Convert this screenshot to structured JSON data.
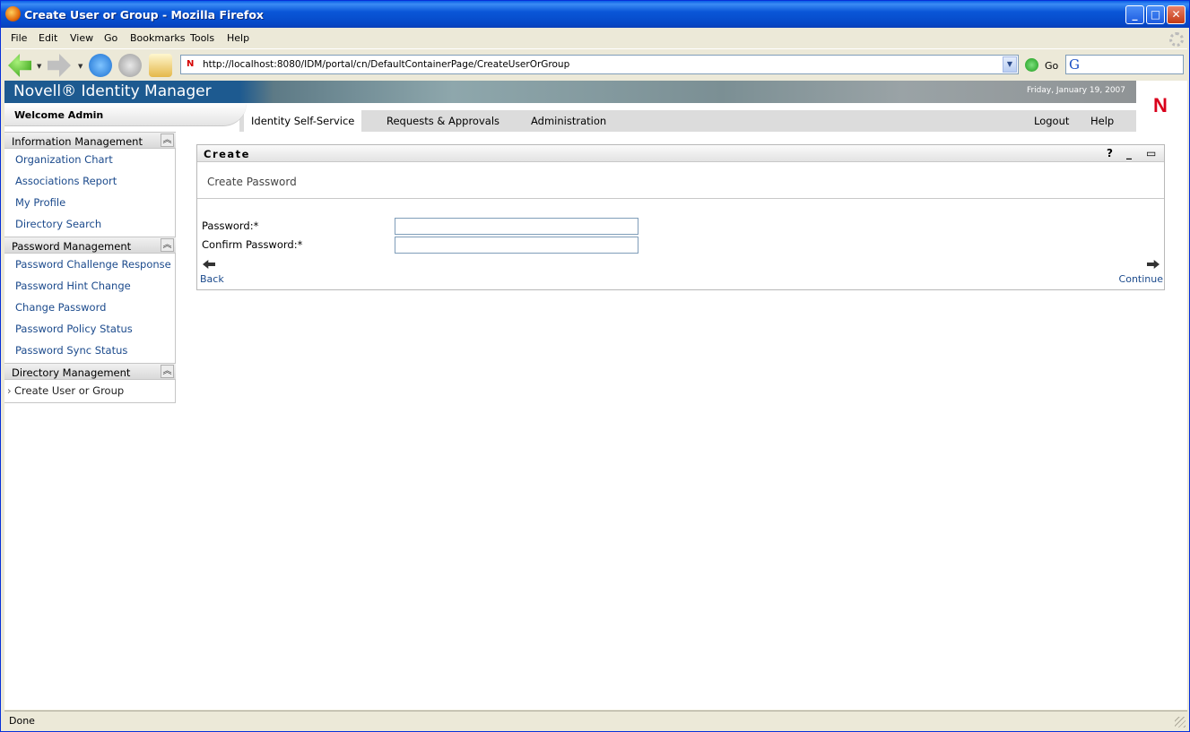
{
  "window": {
    "title": "Create User or Group - Mozilla Firefox",
    "controls": [
      "minimize",
      "maximize",
      "close"
    ]
  },
  "menubar": {
    "items": [
      {
        "label": "File",
        "accel": "F"
      },
      {
        "label": "Edit",
        "accel": "E"
      },
      {
        "label": "View",
        "accel": "V"
      },
      {
        "label": "Go",
        "accel": "G"
      },
      {
        "label": "Bookmarks",
        "accel": "B"
      },
      {
        "label": "Tools",
        "accel": "T"
      },
      {
        "label": "Help",
        "accel": "H"
      }
    ]
  },
  "navbar": {
    "url": "http://localhost:8080/IDM/portal/cn/DefaultContainerPage/CreateUserOrGroup",
    "go_label": "Go",
    "search_engine_glyph": "G"
  },
  "app": {
    "brand": "Novell® Identity Manager",
    "date": "Friday, January 19, 2007",
    "welcome": "Welcome Admin",
    "logo_letter": "N",
    "tabs": [
      "Identity Self-Service",
      "Requests & Approvals",
      "Administration"
    ],
    "active_tab": "Identity Self-Service",
    "right_links": [
      "Logout",
      "Help"
    ]
  },
  "sidebar": {
    "sections": [
      {
        "title": "Information Management",
        "items": [
          "Organization Chart",
          "Associations Report",
          "My Profile",
          "Directory Search"
        ]
      },
      {
        "title": "Password Management",
        "items": [
          "Password Challenge Response",
          "Password Hint Change",
          "Change Password",
          "Password Policy Status",
          "Password Sync Status"
        ]
      },
      {
        "title": "Directory Management",
        "items": [
          "Create User or Group"
        ]
      }
    ],
    "current_item": "Create User or Group"
  },
  "portlet": {
    "title": "Create",
    "header_icons": [
      "help-icon",
      "minimize-icon",
      "maximize-icon"
    ],
    "subtitle": "Create Password",
    "fields": [
      {
        "label": "Password:*",
        "value": ""
      },
      {
        "label": "Confirm Password:*",
        "value": ""
      }
    ],
    "back_label": "Back",
    "continue_label": "Continue"
  },
  "statusbar": {
    "text": "Done"
  }
}
